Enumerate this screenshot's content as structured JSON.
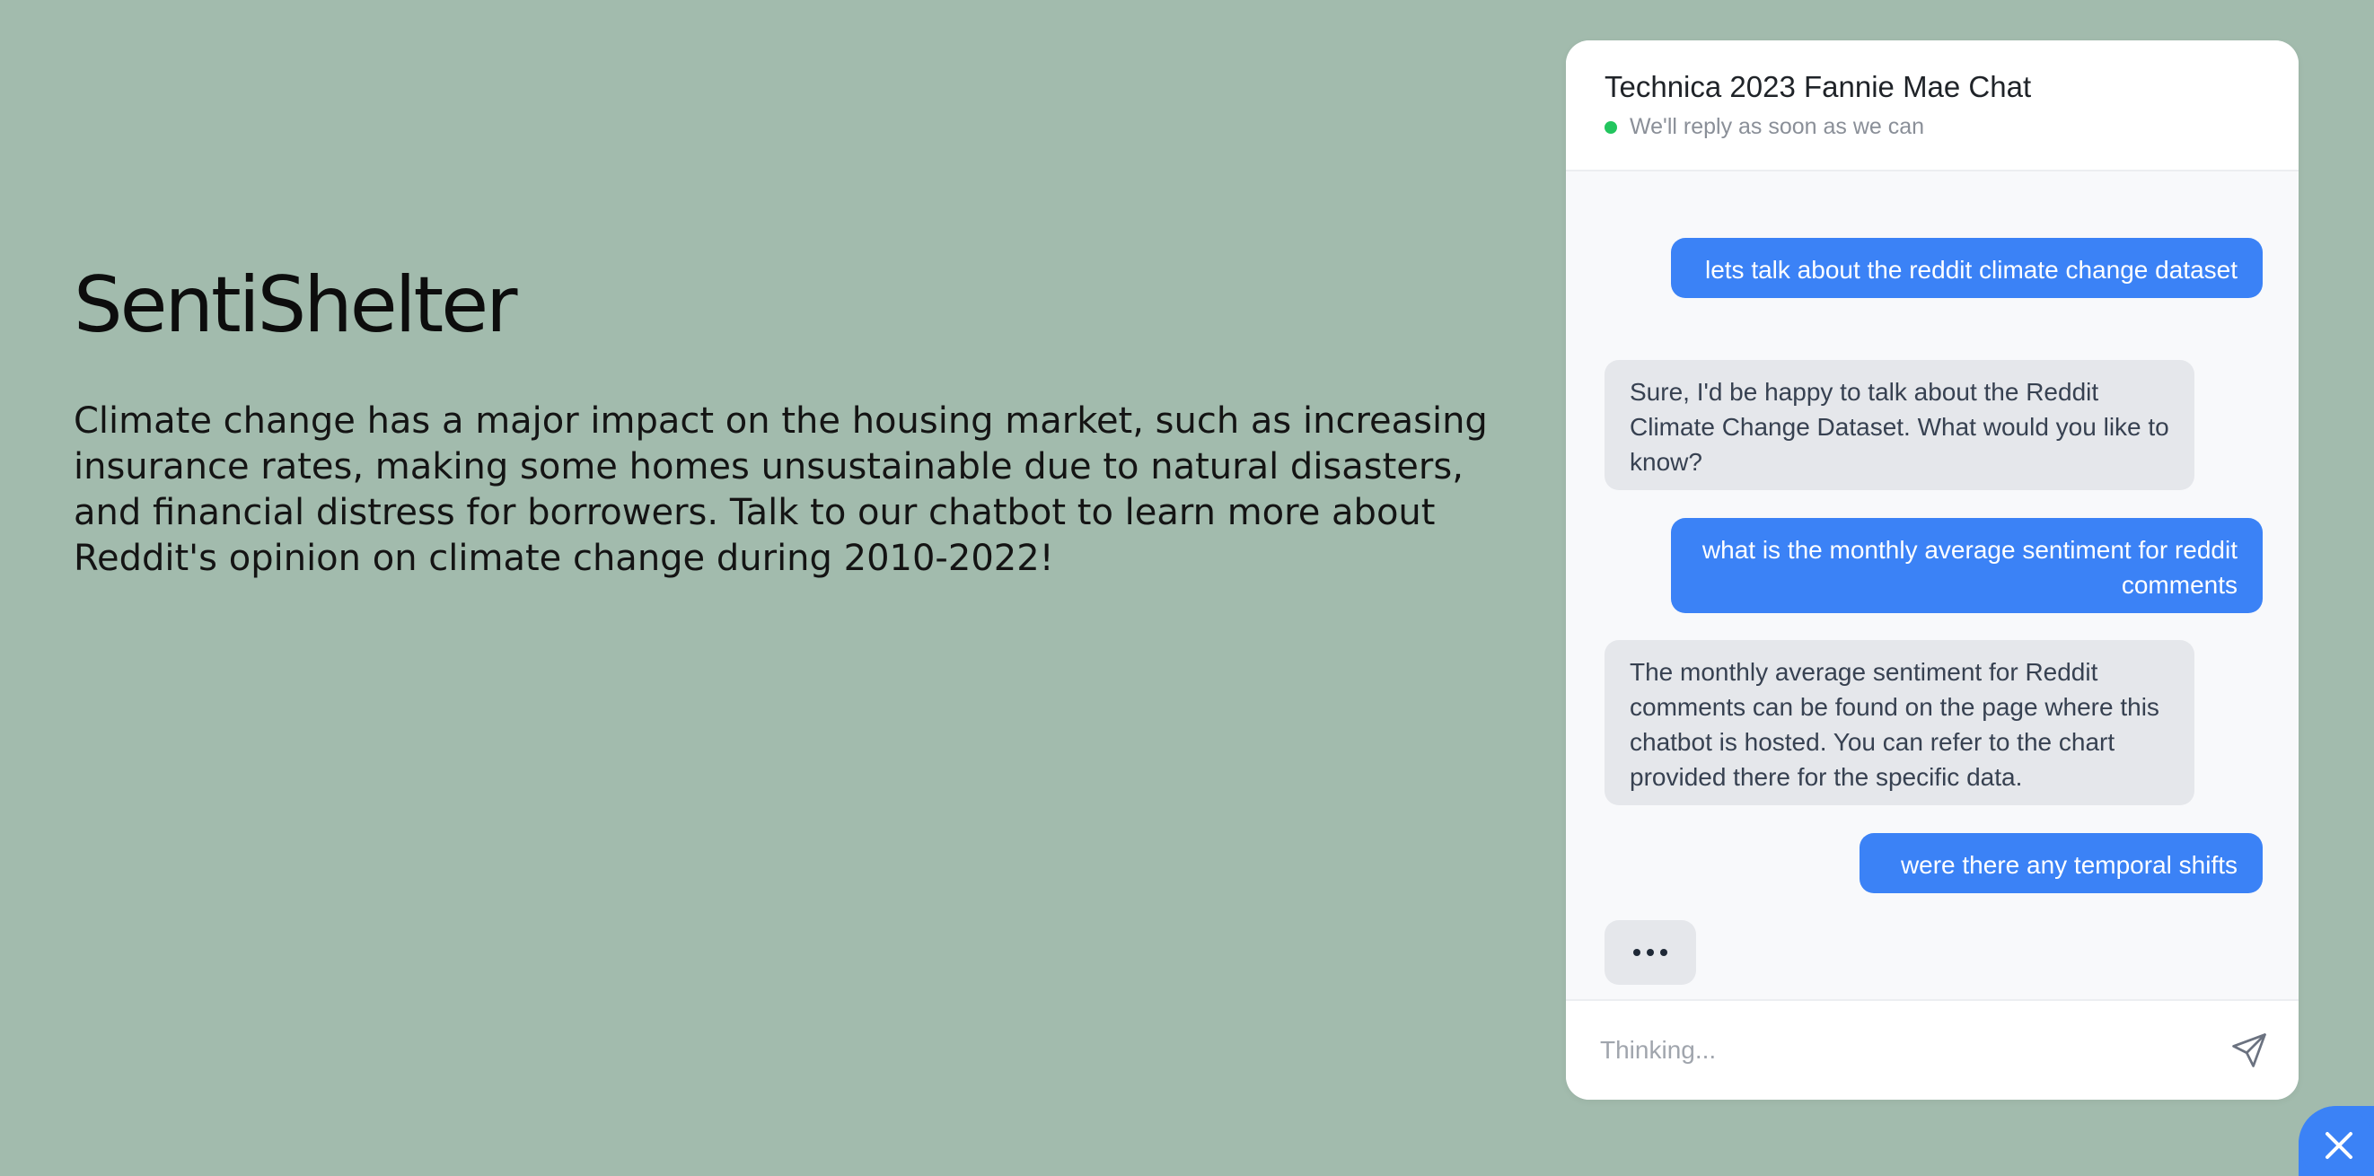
{
  "hero": {
    "title": "SentiShelter",
    "description": "Climate change has a major impact on the housing market, such as increasing insurance rates, making some homes unsustainable due to natural disasters, and financial distress for borrowers. Talk to our chatbot to learn more about Reddit's opinion on climate change during 2010-2022!"
  },
  "chat": {
    "title": "Technica 2023 Fannie Mae Chat",
    "status": "We'll reply as soon as we can",
    "messages": [
      {
        "role": "user",
        "text": "lets talk about the reddit climate change dataset"
      },
      {
        "role": "bot",
        "text": "Sure, I'd be happy to talk about the Reddit Climate Change Dataset. What would you like to know?"
      },
      {
        "role": "user",
        "text": "what is the monthly average sentiment for reddit comments"
      },
      {
        "role": "bot",
        "text": "The monthly average sentiment for Reddit comments can be found on the page where this chatbot is hosted. You can refer to the chart provided there for the specific data."
      },
      {
        "role": "user",
        "text": "were there any temporal shifts"
      }
    ],
    "input": {
      "placeholder": "Thinking...",
      "value": ""
    },
    "send_icon": "send-icon",
    "close_icon": "close-icon",
    "colors": {
      "accent": "#3b82f6",
      "status_dot": "#22c55e",
      "background": "#a2bbad",
      "bot_bubble": "#e5e7eb"
    }
  }
}
